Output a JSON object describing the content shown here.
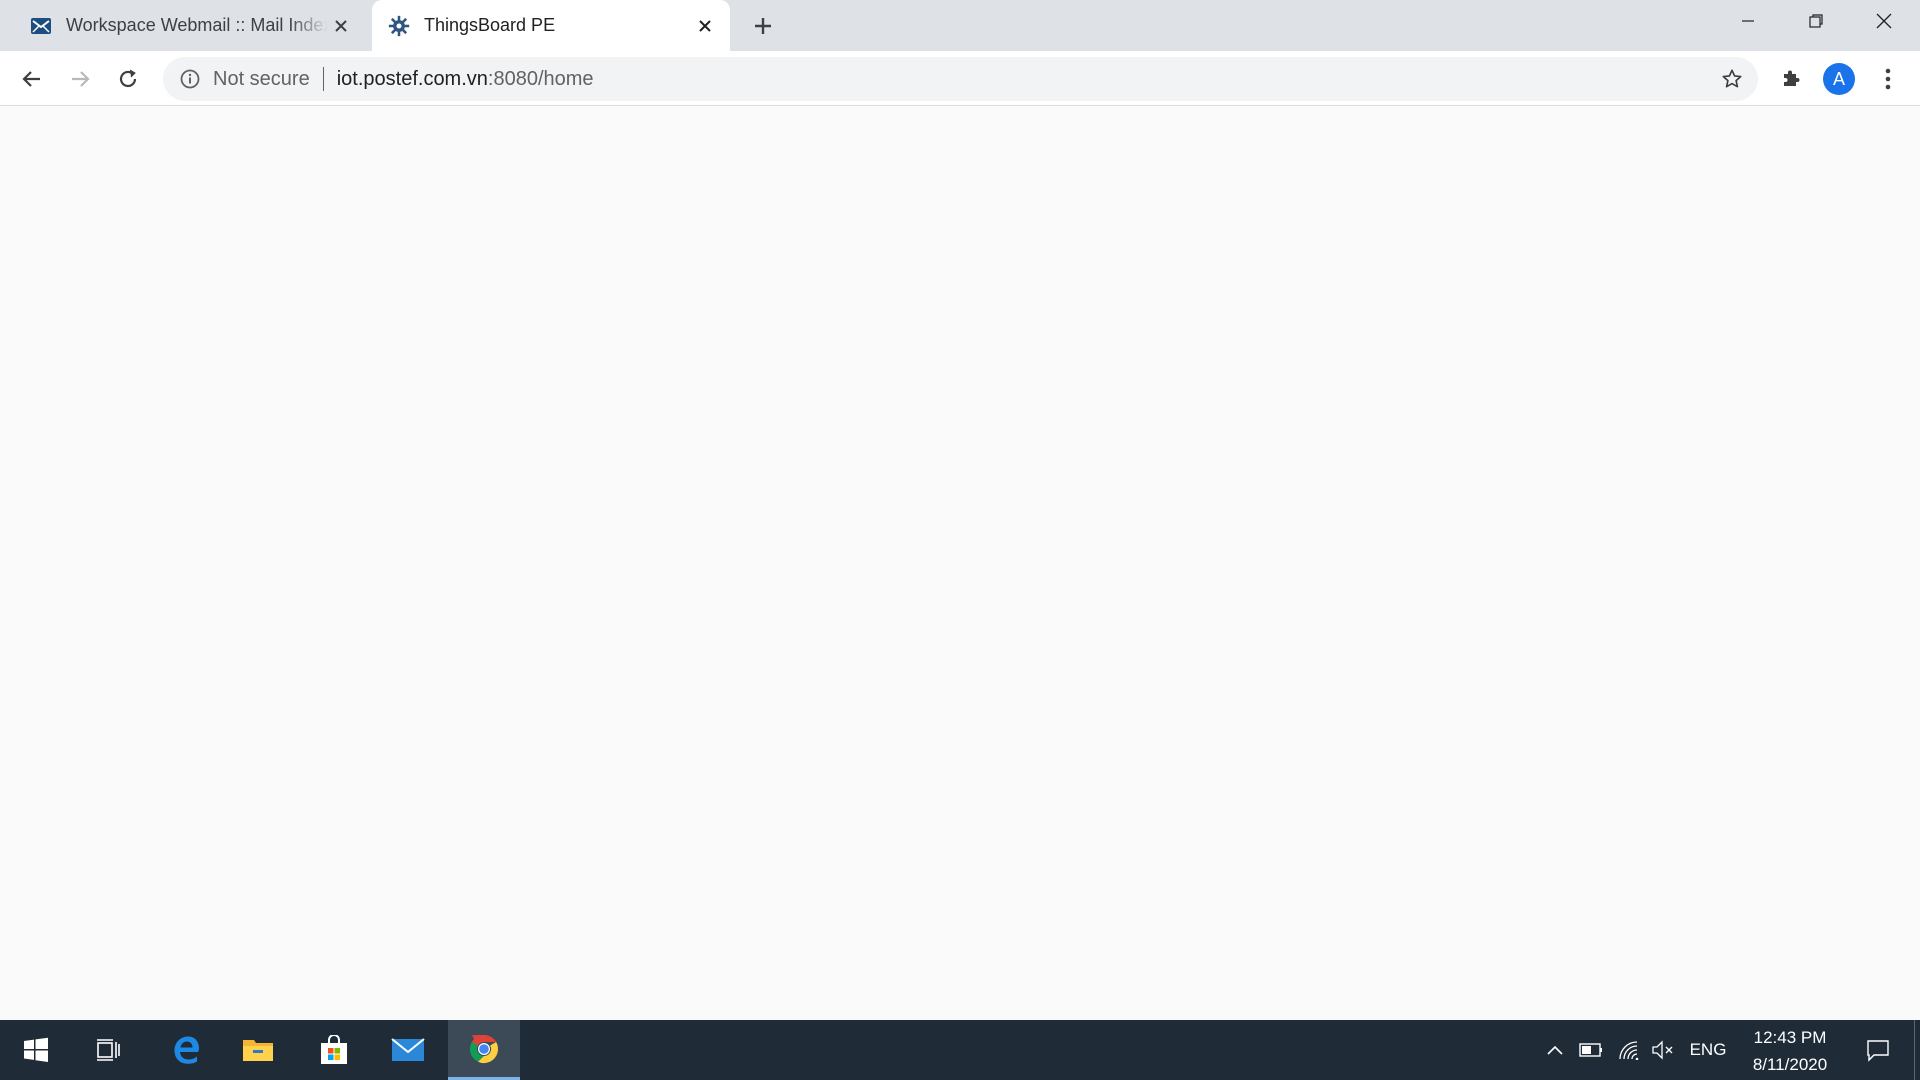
{
  "browser": {
    "tabs": [
      {
        "title": "Workspace Webmail :: Mail Index",
        "favicon": "mail-envelope-icon",
        "active": false
      },
      {
        "title": "ThingsBoard PE",
        "favicon": "thingsboard-gear-icon",
        "active": true
      }
    ],
    "address_bar": {
      "security_label": "Not secure",
      "url_host": "iot.postef.com.vn",
      "url_rest": ":8080/home"
    },
    "profile_initial": "A"
  },
  "taskbar": {
    "apps": [
      "start-icon",
      "task-view-icon",
      "edge-icon",
      "file-explorer-icon",
      "store-icon",
      "mail-icon",
      "chrome-icon"
    ],
    "tray": {
      "language": "ENG",
      "time": "12:43 PM",
      "date": "8/11/2020"
    }
  },
  "colors": {
    "tabstrip": "#dee1e6",
    "taskbar": "#1f2c38",
    "avatar": "#1a73e8",
    "page_background": "#fafafa"
  }
}
